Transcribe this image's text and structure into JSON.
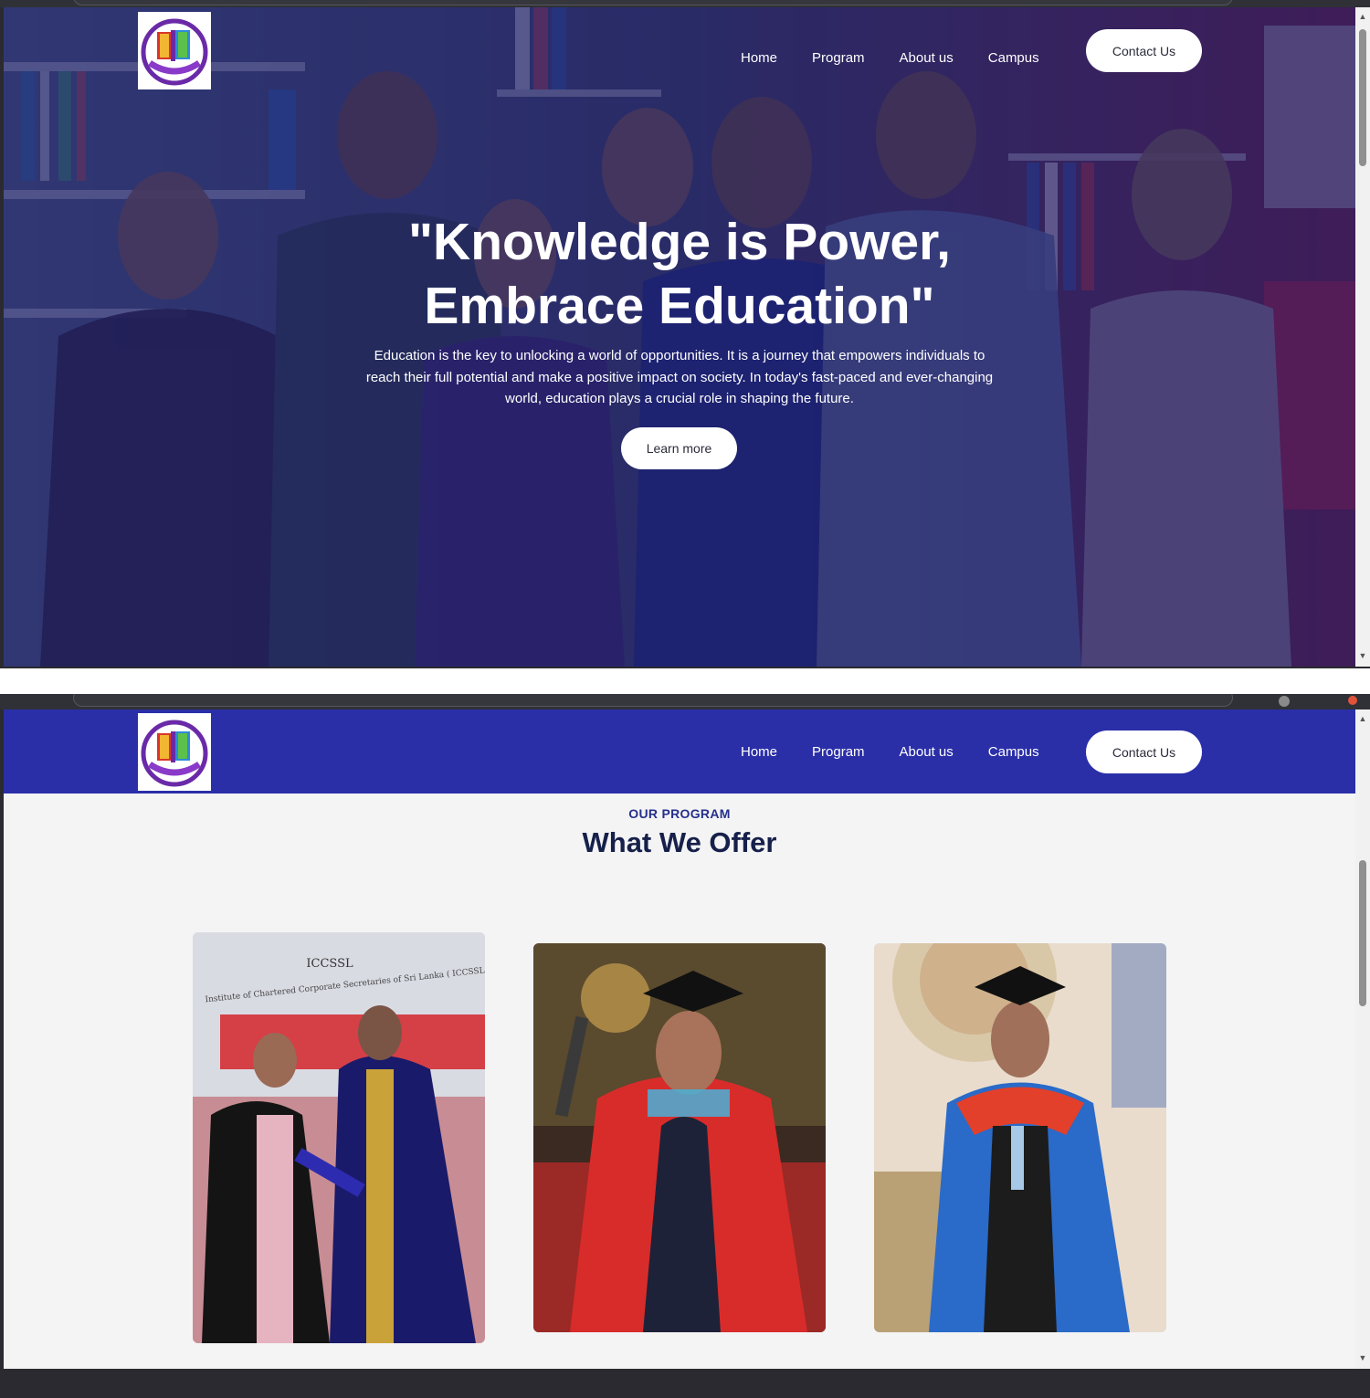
{
  "site": {
    "logo_alt": "Institute logo",
    "nav": {
      "items": [
        {
          "label": "Home"
        },
        {
          "label": "Program"
        },
        {
          "label": "About us"
        },
        {
          "label": "Campus"
        }
      ],
      "cta_label": "Contact Us"
    },
    "colors": {
      "navbar_blue": "#2a2fa8",
      "hero_overlay": "#1c1c6e",
      "eyebrow_blue": "#25308a",
      "heading_dark": "#16204a",
      "section_bg": "#f4f4f5"
    }
  },
  "hero": {
    "title_line1": "\"Knowledge is Power,",
    "title_line2": "Embrace Education\"",
    "paragraph": "Education is the key to unlocking a world of opportunities. It is a journey that empowers individuals to reach their full potential and make a positive impact on society. In today's fast-paced and ever-changing world, education plays a crucial role in shaping the future.",
    "button_label": "Learn more"
  },
  "program": {
    "eyebrow": "OUR PROGRAM",
    "title": "What We Offer",
    "cards": [
      {
        "image": "convocation-photo",
        "banner_text": "ICCSSL",
        "banner_sub": "Institute of Chartered Corporate Secretaries of Sri Lanka ( ICCSSL )"
      },
      {
        "image": "graduate-red-gown-photo"
      },
      {
        "image": "graduate-blue-gown-photo"
      }
    ]
  }
}
